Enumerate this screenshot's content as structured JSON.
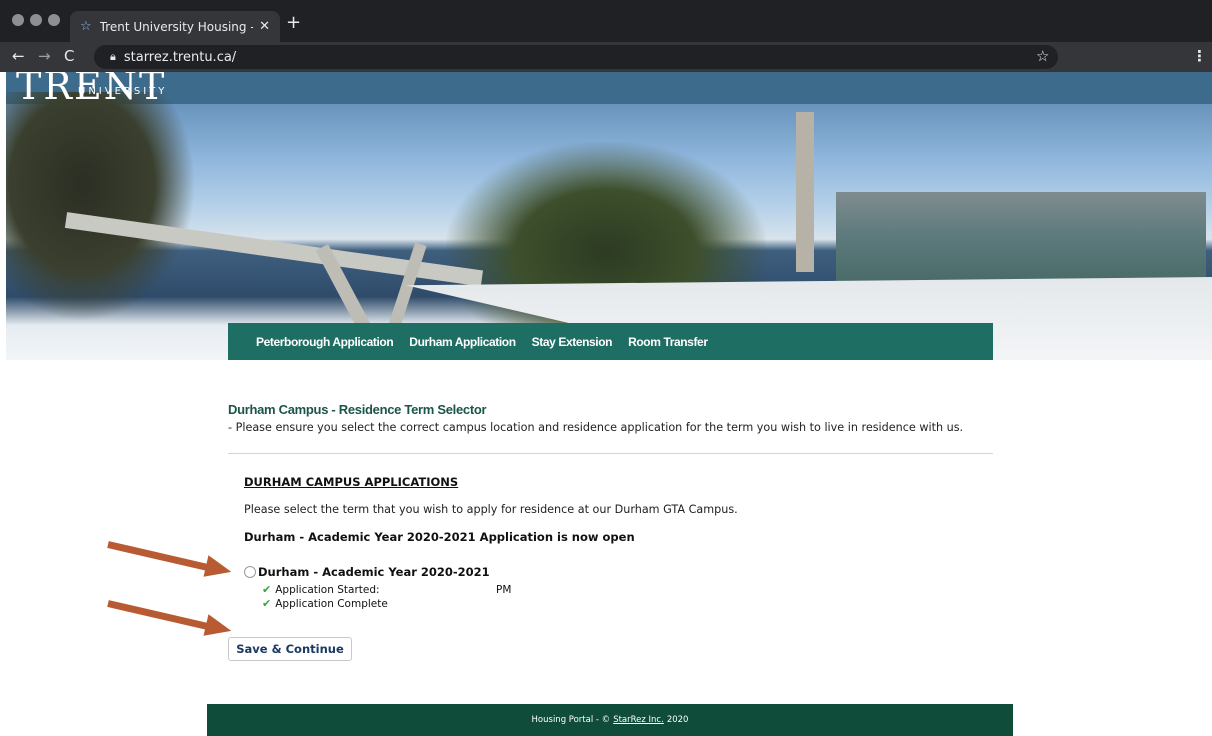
{
  "browser": {
    "tab_title": "Trent University Housing - Dur",
    "tab_favicon": "star-icon",
    "url": "starrez.trentu.ca/",
    "colors": {
      "frame": "#202124",
      "toolbar": "#35363a"
    }
  },
  "brand": {
    "logo_text": "TRENT",
    "logo_sub": "UNIVERSITY"
  },
  "nav": {
    "items": [
      "Peterborough Application",
      "Durham Application",
      "Stay Extension",
      "Room Transfer"
    ],
    "active": "Durham Application",
    "color": "#1f6e64"
  },
  "page": {
    "title": "Durham Campus - Residence Term Selector",
    "subtitle": "- Please ensure you select the correct campus location and residence application for the term you wish to live in residence with us."
  },
  "applications": {
    "heading": "DURHAM CAMPUS APPLICATIONS",
    "description": "Please select the term that you wish to apply for residence at our Durham GTA Campus.",
    "open_notice": "Durham - Academic Year 2020-2021 Application is now open",
    "option_label": "Durham - Academic Year 2020-2021",
    "status_started_label": "Application Started:",
    "status_started_suffix": "PM",
    "status_complete_label": "Application Complete"
  },
  "actions": {
    "save_continue": "Save & Continue"
  },
  "footer": {
    "prefix": "Housing Portal - ©",
    "link": "StarRez Inc.",
    "year": "2020",
    "color": "#0f4d3a"
  },
  "annotations": {
    "arrow_color": "#b85a32"
  }
}
